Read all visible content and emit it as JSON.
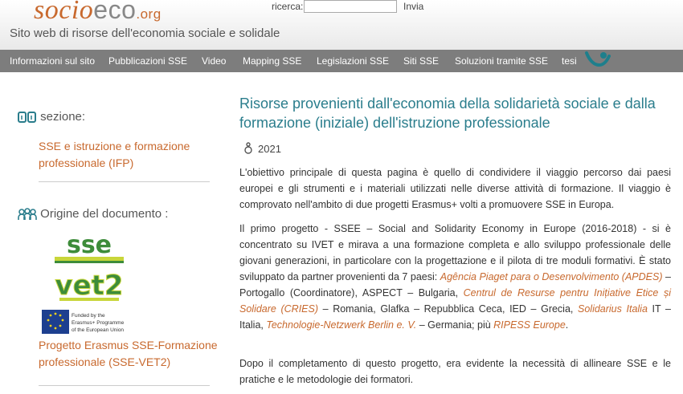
{
  "header": {
    "logo_part1": "socio",
    "logo_part2": "eco",
    "logo_part3": ".org",
    "tagline": "Sito web di risorse dell'economia sociale e solidale",
    "search_label": "ricerca:",
    "search_value": "",
    "search_button": "Invia"
  },
  "nav": {
    "items": [
      "Informazioni sul sito",
      "Pubblicazioni SSE",
      "Video",
      "Mapping SSE",
      "Legislazioni SSE",
      "Siti SSE",
      "Soluzioni tramite SSE",
      "tesi"
    ]
  },
  "sidebar": {
    "section_heading": "sezione:",
    "section_link": "SSE e istruzione e formazione professionale (IFP)",
    "origin_heading": "Origine del documento :",
    "sse_logo_top": "sse",
    "sse_logo_bottom": "vet2",
    "eu_text_1": "Funded by the",
    "eu_text_2": "Erasmus+ Programme",
    "eu_text_3": "of the European Union",
    "project_link": "Progetto Erasmus SSE-Formazione professionale (SSE-VET2)"
  },
  "article": {
    "title": "Risorse provenienti dall'economia della solidarietà sociale e dalla formazione (iniziale) dell'istruzione professionale",
    "year": "2021",
    "para1": "L'obiettivo principale di questa pagina è quello di condividere il viaggio percorso dai paesi europei e gli strumenti e i materiali utilizzati nelle diverse attività di formazione. Il viaggio è comprovato nell'ambito di due progetti Erasmus+ volti a promuovere SSE in Europa.",
    "para2_a": "Il primo progetto - SSEE – Social and Solidarity Economy in Europe (2016-2018) - si è concentrato su IVET e mirava a una formazione completa e allo sviluppo professionale delle giovani generazioni, in particolare con la progettazione e il pilota di tre moduli formativi. È stato sviluppato da partner provenienti da 7 paesi: ",
    "link_apdes": "Agência Piaget para o Desenvolvimento (APDES)",
    "para2_b": " – Portogallo (Coordinatore), ASPECT – Bulgaria, ",
    "link_cries": "Centrul de Resurse pentru Inițiative Etice și Solidare (CRIES)",
    "para2_c": " – Romania, Glafka – Repubblica Ceca, IED – Grecia, ",
    "link_solidarius": "Solidarius Italia",
    "para2_d": " IT – Italia, ",
    "link_tnb": "Technologie-Netzwerk Berlin e. V.",
    "para2_e": " – Germania; più ",
    "link_ripess": "RIPESS Europe",
    "para2_f": ".",
    "para3": "Dopo il completamento di questo progetto, era evidente la necessità di allineare SSE e le pratiche e le metodologie dei formatori."
  },
  "colors": {
    "accent": "#c8692e",
    "title": "#2a7d8c",
    "nav_bg": "#7d7d7d"
  }
}
